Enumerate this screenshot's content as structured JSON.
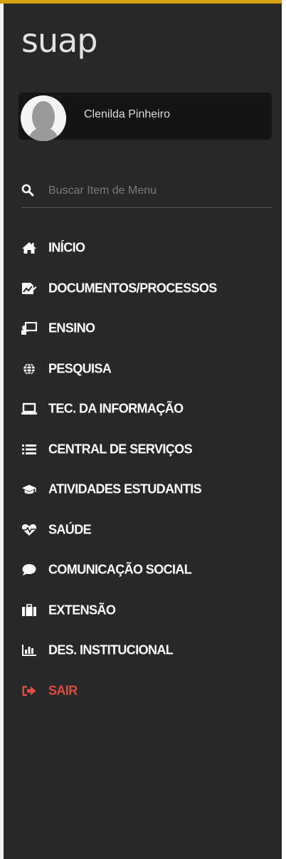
{
  "app": {
    "logo_text": "suap",
    "accent_color": "#d4a20c",
    "background_color": "#282828"
  },
  "user": {
    "name": "Clenilda Pinheiro"
  },
  "search": {
    "placeholder": "Buscar Item de Menu",
    "value": "",
    "icon": "search-icon"
  },
  "menu": {
    "items": [
      {
        "label": "INÍCIO",
        "icon": "home-icon"
      },
      {
        "label": "DOCUMENTOS/PROCESSOS",
        "icon": "document-chart-icon"
      },
      {
        "label": "ENSINO",
        "icon": "teacher-board-icon"
      },
      {
        "label": "PESQUISA",
        "icon": "globe-icon"
      },
      {
        "label": "TEC. DA INFORMAÇÃO",
        "icon": "laptop-icon"
      },
      {
        "label": "CENTRAL DE SERVIÇOS",
        "icon": "list-icon"
      },
      {
        "label": "ATIVIDADES ESTUDANTIS",
        "icon": "graduation-cap-icon"
      },
      {
        "label": "SAÚDE",
        "icon": "heartbeat-icon"
      },
      {
        "label": "COMUNICAÇÃO SOCIAL",
        "icon": "comment-icon"
      },
      {
        "label": "EXTENSÃO",
        "icon": "suitcase-icon"
      },
      {
        "label": "DES. INSTITUCIONAL",
        "icon": "bar-chart-icon"
      },
      {
        "label": "SAIR",
        "icon": "sign-out-icon",
        "color": "#e04a42"
      }
    ]
  }
}
